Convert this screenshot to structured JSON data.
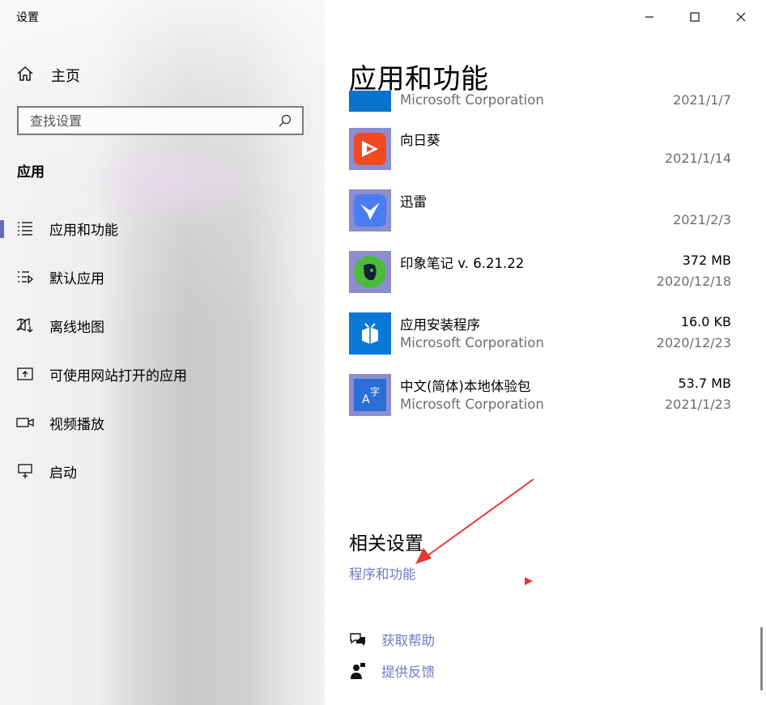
{
  "window": {
    "title": "设置",
    "controls": {
      "minimize": "minimize-icon",
      "maximize": "maximize-icon",
      "close": "close-icon"
    }
  },
  "sidebar": {
    "home_label": "主页",
    "search_placeholder": "查找设置",
    "section_title": "应用",
    "items": [
      {
        "label": "应用和功能",
        "icon": "apps-list-icon",
        "active": true
      },
      {
        "label": "默认应用",
        "icon": "default-apps-icon",
        "active": false
      },
      {
        "label": "离线地图",
        "icon": "offline-map-icon",
        "active": false
      },
      {
        "label": "可使用网站打开的应用",
        "icon": "apps-for-websites-icon",
        "active": false
      },
      {
        "label": "视频播放",
        "icon": "video-playback-icon",
        "active": false
      },
      {
        "label": "启动",
        "icon": "startup-icon",
        "active": false
      }
    ],
    "accent_color": "#6a6ab5"
  },
  "main": {
    "title": "应用和功能",
    "apps": [
      {
        "name": "",
        "publisher": "Microsoft Corporation",
        "size": "",
        "date": "2021/1/7",
        "icon": "partial-blue-app-icon"
      },
      {
        "name": "向日葵",
        "publisher": "",
        "size": "",
        "date": "2021/1/14",
        "icon": "sunflower-icon"
      },
      {
        "name": "迅雷",
        "publisher": "",
        "size": "",
        "date": "2021/2/3",
        "icon": "xunlei-bird-icon"
      },
      {
        "name": "印象笔记 v. 6.21.22",
        "publisher": "",
        "size": "372 MB",
        "date": "2020/12/18",
        "icon": "evernote-elephant-icon"
      },
      {
        "name": "应用安装程序",
        "publisher": "Microsoft Corporation",
        "size": "16.0 KB",
        "date": "2020/12/23",
        "icon": "app-installer-box-icon"
      },
      {
        "name": "中文(简体)本地体验包",
        "publisher": "Microsoft Corporation",
        "size": "53.7 MB",
        "date": "2021/1/23",
        "icon": "language-pack-icon"
      }
    ],
    "related": {
      "title": "相关设置",
      "link": "程序和功能"
    },
    "help": [
      {
        "label": "获取帮助",
        "icon": "help-chat-icon"
      },
      {
        "label": "提供反馈",
        "icon": "feedback-person-icon"
      }
    ],
    "link_color": "#7676c4",
    "annotation_color": "#e53935"
  }
}
